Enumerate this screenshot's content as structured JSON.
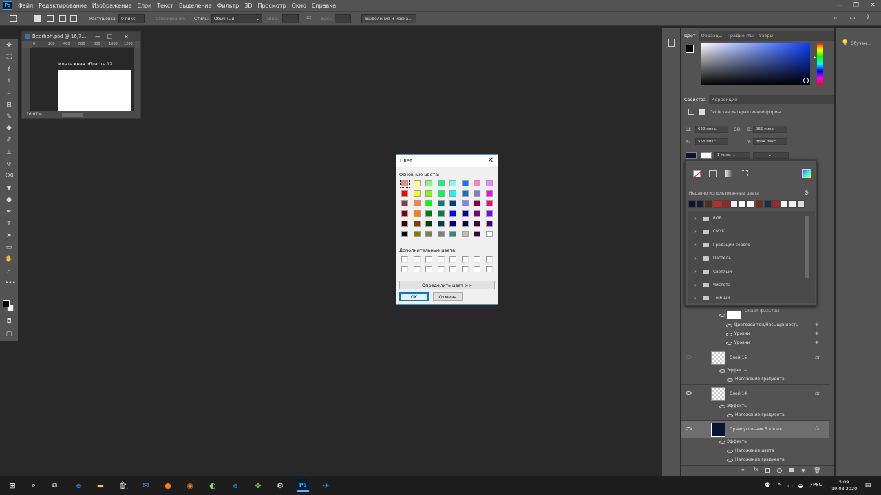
{
  "app": {
    "logo": "Ps"
  },
  "menu": [
    "Файл",
    "Редактирование",
    "Изображение",
    "Слои",
    "Текст",
    "Выделение",
    "Фильтр",
    "3D",
    "Просмотр",
    "Окно",
    "Справка"
  ],
  "options_bar": {
    "feather_label": "Растушевка:",
    "feather_value": "0 пикс.",
    "antialias_label": "Сглаживание",
    "style_label": "Стиль:",
    "style_value": "Обычный",
    "width_label": "Шир.:",
    "height_label": "Выс.:",
    "select_mask_button": "Выделение и маска..."
  },
  "document": {
    "tab_title": "Beerhoff.psd @ 16,7...",
    "artboard_label": "Монтажная область 12",
    "zoom": "16,67%",
    "ruler_ticks": [
      "0",
      "200",
      "400",
      "600",
      "800",
      "1000",
      "1200"
    ]
  },
  "color_panel": {
    "tabs": [
      "Цвет",
      "Образцы",
      "Градиенты",
      "Узоры"
    ],
    "active_tab": 0,
    "hue_base": "#0a3fff"
  },
  "properties_panel": {
    "tabs": [
      "Свойства",
      "Коррекция"
    ],
    "active_tab": 0,
    "header": "Свойства интерактивной формы",
    "w_label": "Ш:",
    "w_value": "622 пикс.",
    "link_label": "GO",
    "h_label": "В:",
    "h_value": "965 пикс.",
    "x_label": "X:",
    "x_value": "558 пикс.",
    "y_label": "Y:",
    "y_value": "3864 пикс.",
    "stroke_width": "1 пикс."
  },
  "swatches_popup": {
    "recent_label": "Недавно использованные цвета",
    "recent_colors": [
      "#0d1230",
      "#101a3a",
      "#5a2a18",
      "#c8281e",
      "#a82218",
      "#f0f0f0",
      "#ffffff",
      "#f8f8f8",
      "#7a2a18",
      "#1a2e4e",
      "#b02420",
      "#f4f4f4",
      "#f0f0f0",
      "#dcdcdc"
    ],
    "groups": [
      "RGB",
      "CMYK",
      "Градации серого",
      "Пастель",
      "Светлый",
      "Чистота",
      "Темный"
    ]
  },
  "learn_panel": {
    "label": "Обучен..."
  },
  "layers": {
    "items": [
      {
        "name": "Смарт-фильтры",
        "kind": "smart"
      },
      {
        "name": "Цветовой тон/Насыщенность",
        "kind": "filter"
      },
      {
        "name": "Уровни",
        "kind": "filter"
      },
      {
        "name": "Уровни",
        "kind": "filter"
      },
      {
        "name": "Слой 15",
        "kind": "layer",
        "fx": "fx"
      },
      {
        "name": "Эффекты",
        "kind": "effects"
      },
      {
        "name": "Наложение градиента",
        "kind": "effect"
      },
      {
        "name": "Слой 14",
        "kind": "layer",
        "fx": "fx"
      },
      {
        "name": "Эффекты",
        "kind": "effects"
      },
      {
        "name": "Наложение градиента",
        "kind": "effect"
      },
      {
        "name": "Прямоугольник 5 копия",
        "kind": "layer",
        "fx": "fx"
      },
      {
        "name": "Эффекты",
        "kind": "effects"
      },
      {
        "name": "Наложение цвета",
        "kind": "effect"
      },
      {
        "name": "Наложение градиента",
        "kind": "effect"
      }
    ]
  },
  "color_dialog": {
    "title": "Цвет",
    "basic_label": "Основные цвета:",
    "custom_label": "Дополнительные цвета:",
    "define_button": "Определить цвет >>",
    "ok_button": "OK",
    "cancel_button": "Отмена",
    "basic_colors": [
      "#ff8080",
      "#ffff80",
      "#80ff80",
      "#00ff80",
      "#80ffff",
      "#0080ff",
      "#ff80c0",
      "#ff80ff",
      "#ff0000",
      "#ffff00",
      "#80ff00",
      "#00ff40",
      "#00ffff",
      "#0080c0",
      "#8080c0",
      "#ff00ff",
      "#804040",
      "#ff8040",
      "#00ff00",
      "#008080",
      "#004080",
      "#8080ff",
      "#800040",
      "#ff0080",
      "#800000",
      "#ff8000",
      "#008000",
      "#008040",
      "#0000ff",
      "#0000a0",
      "#800080",
      "#8000ff",
      "#400000",
      "#804000",
      "#004000",
      "#004040",
      "#000080",
      "#000040",
      "#400040",
      "#400080",
      "#000000",
      "#808000",
      "#808040",
      "#808080",
      "#408080",
      "#c0c0c0",
      "#400040",
      "#ffffff"
    ]
  },
  "taskbar": {
    "time": "5:09",
    "date": "19.03.2020",
    "lang": "РУС"
  }
}
